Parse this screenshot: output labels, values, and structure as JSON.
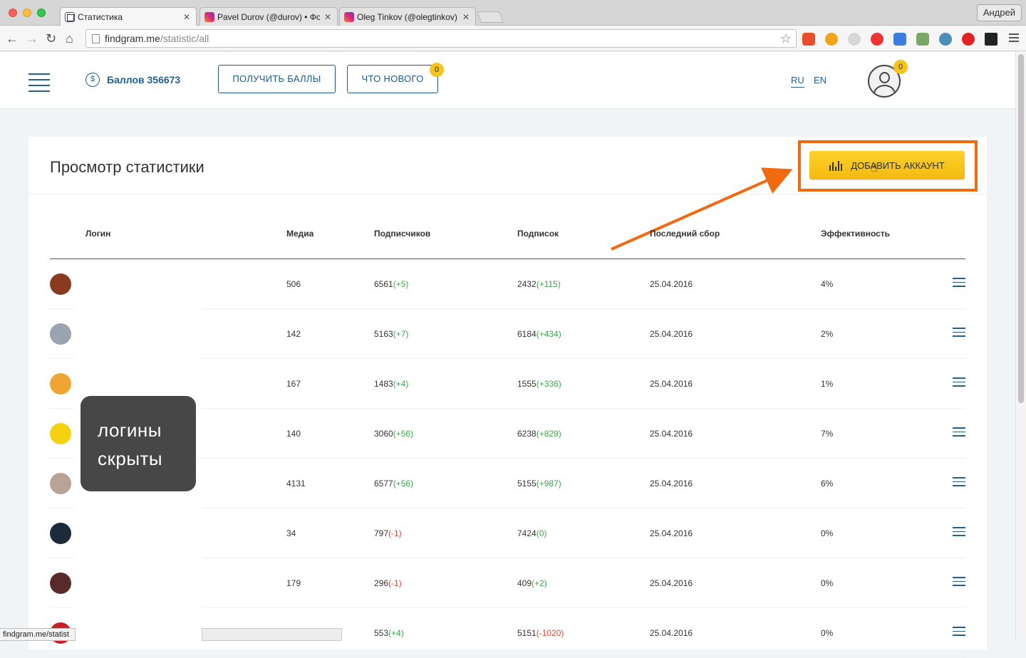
{
  "browser": {
    "tabs": [
      {
        "title": "Статистика",
        "active": true
      },
      {
        "title": "Pavel Durov (@durov) • Фо",
        "active": false
      },
      {
        "title": "Oleg Tinkov (@olegtinkov)",
        "active": false
      }
    ],
    "user_name": "Андрей",
    "url_host": "findgram.me",
    "url_path": "/statistic/all",
    "status_url": "findgram.me/statist"
  },
  "header": {
    "balance_label": "Баллов 356673",
    "coin_symbol": "$",
    "get_points_label": "ПОЛУЧИТЬ БАЛЛЫ",
    "whats_new_label": "ЧТО НОВОГО",
    "whats_new_badge": "0",
    "lang_ru": "RU",
    "lang_en": "EN",
    "profile_badge": "0"
  },
  "card": {
    "title": "Просмотр статистики",
    "add_account_label": "ДОБАВИТЬ АККАУНТ"
  },
  "table": {
    "headers": [
      "Логин",
      "Медиа",
      "Подписчиков",
      "Подписок",
      "Последний сбор",
      "Эффективность"
    ],
    "rows": [
      {
        "media": "506",
        "followers": "6561",
        "followers_delta": "(+5)",
        "followers_sign": "pos",
        "following": "2432",
        "following_delta": "(+115)",
        "following_sign": "pos",
        "date": "25.04.2016",
        "eff": "4%",
        "avatar_color": "#8a3a1e"
      },
      {
        "media": "142",
        "followers": "5163",
        "followers_delta": "(+7)",
        "followers_sign": "pos",
        "following": "6184",
        "following_delta": "(+434)",
        "following_sign": "pos",
        "date": "25.04.2016",
        "eff": "2%",
        "avatar_color": "#9aa3b0"
      },
      {
        "media": "167",
        "followers": "1483",
        "followers_delta": "(+4)",
        "followers_sign": "pos",
        "following": "1555",
        "following_delta": "(+336)",
        "following_sign": "pos",
        "date": "25.04.2016",
        "eff": "1%",
        "avatar_color": "#f0a532"
      },
      {
        "media": "140",
        "followers": "3060",
        "followers_delta": "(+56)",
        "followers_sign": "pos",
        "following": "6238",
        "following_delta": "(+829)",
        "following_sign": "pos",
        "date": "25.04.2016",
        "eff": "7%",
        "avatar_color": "#f4d20f"
      },
      {
        "media": "4131",
        "followers": "6577",
        "followers_delta": "(+56)",
        "followers_sign": "pos",
        "following": "5155",
        "following_delta": "(+987)",
        "following_sign": "pos",
        "date": "25.04.2016",
        "eff": "6%",
        "avatar_color": "#b9a395"
      },
      {
        "media": "34",
        "followers": "797",
        "followers_delta": "(-1)",
        "followers_sign": "neg",
        "following": "7424",
        "following_delta": "(0)",
        "following_sign": "pos",
        "date": "25.04.2016",
        "eff": "0%",
        "avatar_color": "#1c2a3a"
      },
      {
        "media": "179",
        "followers": "296",
        "followers_delta": "(-1)",
        "followers_sign": "neg",
        "following": "409",
        "following_delta": "(+2)",
        "following_sign": "pos",
        "date": "25.04.2016",
        "eff": "0%",
        "avatar_color": "#5a2a2a"
      },
      {
        "media": "",
        "followers": "553",
        "followers_delta": "(+4)",
        "followers_sign": "pos",
        "following": "5151",
        "following_delta": "(-1020)",
        "following_sign": "neg",
        "date": "25.04.2016",
        "eff": "0%",
        "avatar_color": "#c8202a"
      }
    ]
  },
  "overlay": {
    "line1": "логины",
    "line2": "скрыты"
  },
  "colors": {
    "brand": "#22618f",
    "accent_yellow": "#f6c21b",
    "highlight_orange": "#f26a0f",
    "positive": "#3aa84c",
    "negative": "#d64a3a"
  }
}
